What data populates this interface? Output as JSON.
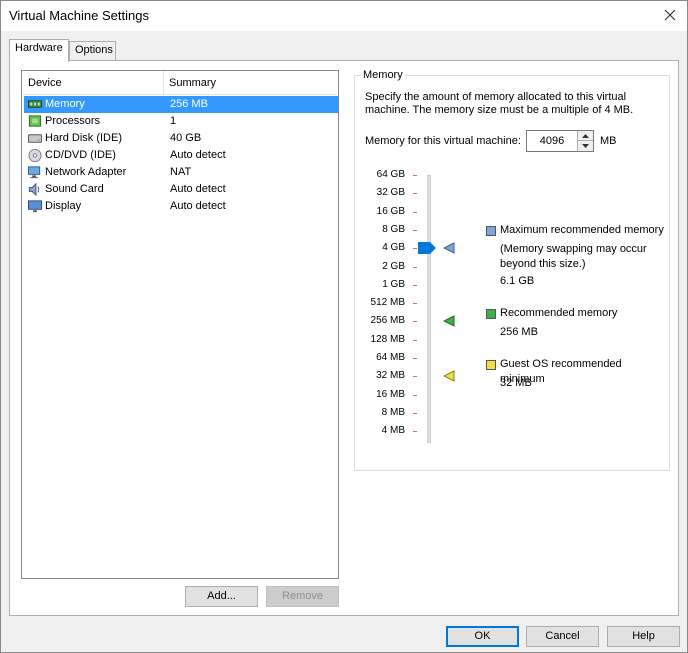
{
  "window": {
    "title": "Virtual Machine Settings"
  },
  "tabs": [
    {
      "label": "Hardware",
      "active": true
    },
    {
      "label": "Options",
      "active": false
    }
  ],
  "device_list": {
    "columns": [
      "Device",
      "Summary"
    ],
    "items": [
      {
        "icon": "memory-icon",
        "name": "Memory",
        "summary": "256 MB",
        "selected": true
      },
      {
        "icon": "processor-icon",
        "name": "Processors",
        "summary": "1",
        "selected": false
      },
      {
        "icon": "hard-disk-icon",
        "name": "Hard Disk (IDE)",
        "summary": "40 GB",
        "selected": false
      },
      {
        "icon": "cd-dvd-icon",
        "name": "CD/DVD (IDE)",
        "summary": "Auto detect",
        "selected": false
      },
      {
        "icon": "network-adapter-icon",
        "name": "Network Adapter",
        "summary": "NAT",
        "selected": false
      },
      {
        "icon": "sound-card-icon",
        "name": "Sound Card",
        "summary": "Auto detect",
        "selected": false
      },
      {
        "icon": "display-icon",
        "name": "Display",
        "summary": "Auto detect",
        "selected": false
      }
    ]
  },
  "list_buttons": {
    "add": "Add...",
    "remove": "Remove"
  },
  "memory": {
    "group_label": "Memory",
    "description": "Specify the amount of memory allocated to this virtual machine. The memory size must be a multiple of 4 MB.",
    "field_label": "Memory for this virtual machine:",
    "value": "4096",
    "unit": "MB",
    "scale": [
      "64 GB",
      "32 GB",
      "16 GB",
      "8 GB",
      "4 GB",
      "2 GB",
      "1 GB",
      "512 MB",
      "256 MB",
      "128 MB",
      "64 MB",
      "32 MB",
      "16 MB",
      "8 MB",
      "4 MB"
    ],
    "slider_value": "4 GB",
    "legend": {
      "max": {
        "label": "Maximum recommended memory",
        "note": "(Memory swapping may occur beyond this size.)",
        "value": "6.1 GB",
        "color": "#7ea6d6",
        "marker_at": "4 GB"
      },
      "recommended": {
        "label": "Recommended memory",
        "value": "256 MB",
        "color": "#3cb043",
        "marker_at": "256 MB"
      },
      "guest_min": {
        "label": "Guest OS recommended minimum",
        "value": "32 MB",
        "color": "#f0e040",
        "marker_at": "32 MB"
      }
    }
  },
  "dialog_buttons": {
    "ok": "OK",
    "cancel": "Cancel",
    "help": "Help"
  },
  "colors": {
    "selection": "#3399ff",
    "slider_thumb": "#0078d7",
    "default_button_border": "#0078d7"
  }
}
